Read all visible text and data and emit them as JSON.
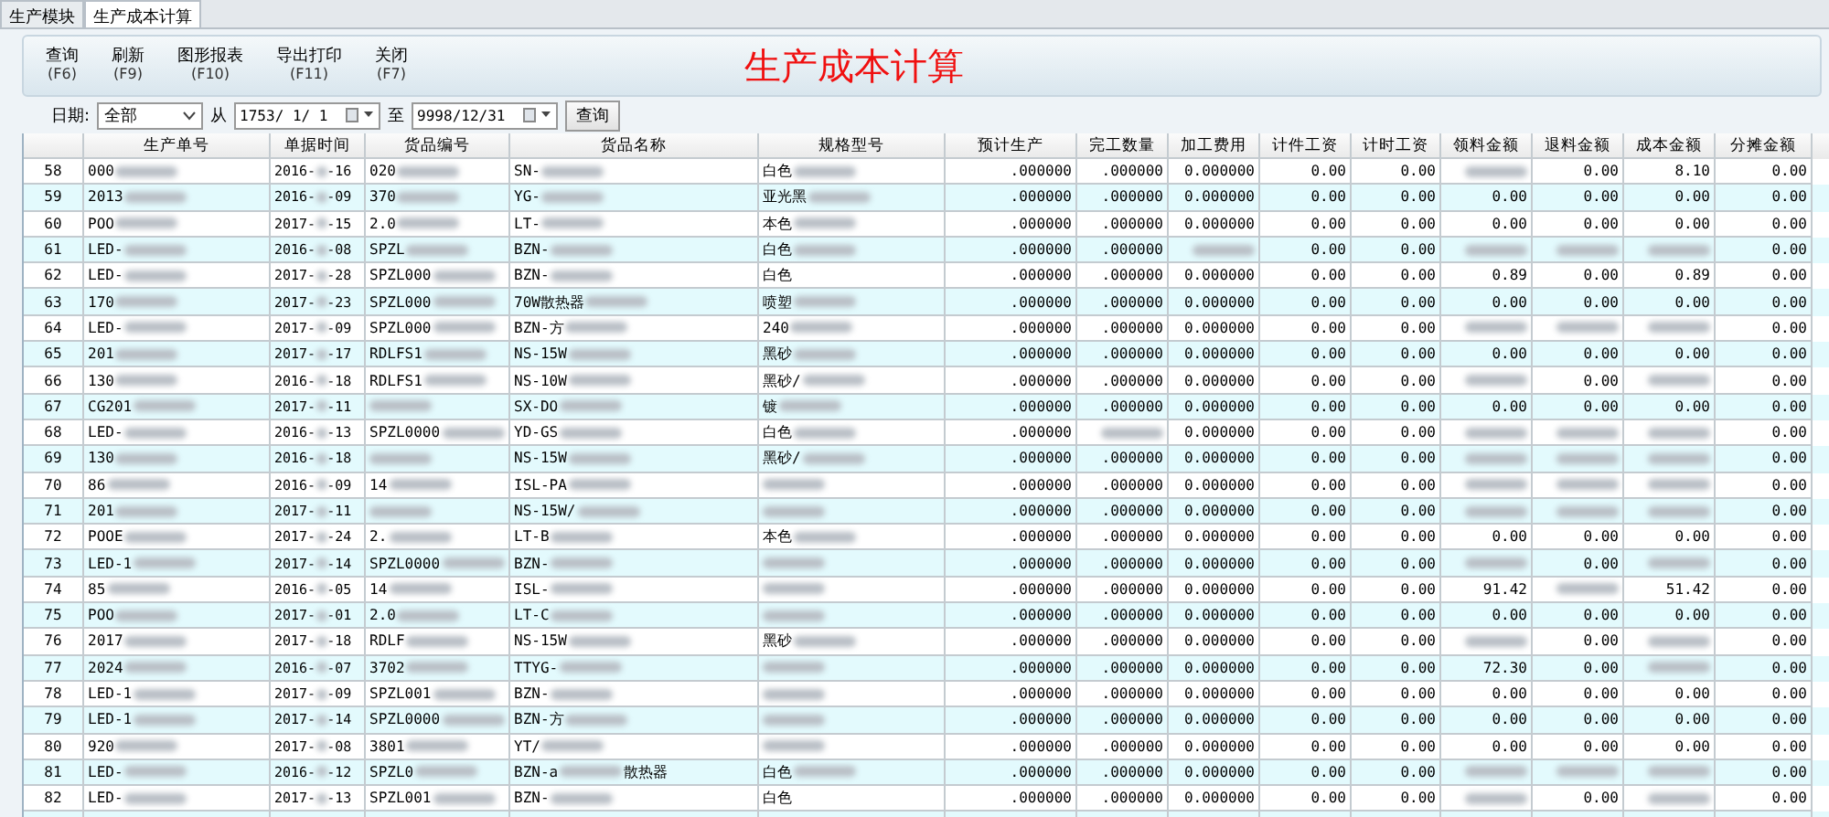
{
  "tabs": [
    {
      "label": "生产模块",
      "selected": false
    },
    {
      "label": "生产成本计算",
      "selected": true
    }
  ],
  "toolbar": [
    {
      "label": "查询",
      "key": "(F6)"
    },
    {
      "label": "刷新",
      "key": "(F9)"
    },
    {
      "label": "图形报表",
      "key": "(F10)"
    },
    {
      "label": "导出打印",
      "key": "(F11)"
    },
    {
      "label": "关闭",
      "key": "(F7)"
    }
  ],
  "title": "生产成本计算",
  "filter": {
    "date_label": "日期:",
    "range": "全部",
    "from_label": "从",
    "from": "1753/ 1/ 1",
    "to_label": "至",
    "to": "9998/12/31",
    "query": "查询"
  },
  "table": {
    "columns": [
      "",
      "生产单号",
      "单据时间",
      "货品编号",
      "货品名称",
      "规格型号",
      "预计生产",
      "完工数量",
      "加工费用",
      "计件工资",
      "计时工资",
      "领料金额",
      "退料金额",
      "成本金额",
      "分摊金额"
    ],
    "rows": [
      [
        "58",
        {
          "text": "000",
          "redacted": true
        },
        {
          "text": "2016-",
          "redacted": true,
          "tail": "-16"
        },
        {
          "text": "020",
          "redacted": true
        },
        {
          "text": "SN-",
          "redacted": true
        },
        {
          "text": "白色",
          "redacted": true
        },
        ".000000",
        ".000000",
        "0.000000",
        "0.00",
        "0.00",
        {
          "redacted": true
        },
        "0.00",
        "8.10",
        "0.00"
      ],
      [
        "59",
        {
          "text": "2013",
          "redacted": true
        },
        {
          "text": "2016-",
          "redacted": true,
          "tail": "-09"
        },
        {
          "text": "370",
          "redacted": true
        },
        {
          "text": "YG-",
          "redacted": true
        },
        {
          "text": "亚光黑",
          "redacted": true
        },
        ".000000",
        ".000000",
        "0.000000",
        "0.00",
        "0.00",
        "0.00",
        "0.00",
        "0.00",
        "0.00"
      ],
      [
        "60",
        {
          "text": "POO",
          "redacted": true
        },
        {
          "text": "2017-",
          "redacted": true,
          "tail": "-15"
        },
        {
          "text": "2.0",
          "redacted": true
        },
        {
          "text": "LT-",
          "redacted": true
        },
        {
          "text": "本色",
          "redacted": true
        },
        ".000000",
        ".000000",
        "0.000000",
        "0.00",
        "0.00",
        "0.00",
        "0.00",
        "0.00",
        "0.00"
      ],
      [
        "61",
        {
          "text": "LED-",
          "redacted": true
        },
        {
          "text": "2016-",
          "redacted": true,
          "tail": "-08"
        },
        {
          "text": "SPZL",
          "redacted": true
        },
        {
          "text": "BZN-",
          "redacted": true
        },
        {
          "text": "白色",
          "redacted": true
        },
        ".000000",
        ".000000",
        {
          "redacted": true
        },
        "0.00",
        "0.00",
        {
          "redacted": true
        },
        {
          "redacted": true
        },
        {
          "redacted": true
        },
        "0.00"
      ],
      [
        "62",
        {
          "text": "LED-",
          "redacted": true
        },
        {
          "text": "2017-",
          "redacted": true,
          "tail": "-28"
        },
        {
          "text": "SPZL000",
          "redacted": true
        },
        {
          "text": "BZN-",
          "redacted": true
        },
        "白色",
        ".000000",
        ".000000",
        "0.000000",
        "0.00",
        "0.00",
        "0.89",
        "0.00",
        "0.89",
        "0.00"
      ],
      [
        "63",
        {
          "text": "170",
          "redacted": true
        },
        {
          "text": "2017-",
          "redacted": true,
          "tail": "-23"
        },
        {
          "text": "SPZL000",
          "redacted": true
        },
        {
          "text": "70W散热器",
          "redacted": true
        },
        {
          "text": "喷塑",
          "redacted": true
        },
        ".000000",
        ".000000",
        "0.000000",
        "0.00",
        "0.00",
        "0.00",
        "0.00",
        "0.00",
        "0.00"
      ],
      [
        "64",
        {
          "text": "LED-",
          "redacted": true
        },
        {
          "text": "2017-",
          "redacted": true,
          "tail": "-09"
        },
        {
          "text": "SPZL000",
          "redacted": true
        },
        {
          "text": "BZN-方",
          "redacted": true
        },
        {
          "text": "240",
          "redacted": true
        },
        ".000000",
        ".000000",
        "0.000000",
        "0.00",
        "0.00",
        {
          "redacted": true
        },
        {
          "redacted": true
        },
        {
          "redacted": true
        },
        "0.00"
      ],
      [
        "65",
        {
          "text": "201",
          "redacted": true
        },
        {
          "text": "2017-",
          "redacted": true,
          "tail": "-17"
        },
        {
          "text": "RDLFS1",
          "redacted": true
        },
        {
          "text": "NS-15W",
          "redacted": true
        },
        {
          "text": "黑砂",
          "redacted": true
        },
        ".000000",
        ".000000",
        "0.000000",
        "0.00",
        "0.00",
        "0.00",
        "0.00",
        "0.00",
        "0.00"
      ],
      [
        "66",
        {
          "text": "130",
          "redacted": true
        },
        {
          "text": "2016-",
          "redacted": true,
          "tail": "-18"
        },
        {
          "text": "RDLFS1",
          "redacted": true
        },
        {
          "text": "NS-10W",
          "redacted": true
        },
        {
          "text": "黑砂/",
          "redacted": true
        },
        ".000000",
        ".000000",
        "0.000000",
        "0.00",
        "0.00",
        {
          "redacted": true
        },
        "0.00",
        {
          "redacted": true
        },
        "0.00"
      ],
      [
        "67",
        {
          "text": "CG201",
          "redacted": true
        },
        {
          "text": "2017-",
          "redacted": true,
          "tail": "-11"
        },
        {
          "redacted": true
        },
        {
          "text": "SX-DO",
          "redacted": true
        },
        {
          "text": "镀",
          "redacted": true
        },
        ".000000",
        ".000000",
        "0.000000",
        "0.00",
        "0.00",
        "0.00",
        "0.00",
        "0.00",
        "0.00"
      ],
      [
        "68",
        {
          "text": "LED-",
          "redacted": true
        },
        {
          "text": "2016-",
          "redacted": true,
          "tail": "-13"
        },
        {
          "text": "SPZL0000",
          "redacted": true
        },
        {
          "text": "YD-GS",
          "redacted": true
        },
        {
          "text": "白色",
          "redacted": true
        },
        ".000000",
        {
          "redacted": true
        },
        "0.000000",
        "0.00",
        "0.00",
        {
          "redacted": true
        },
        {
          "redacted": true
        },
        {
          "redacted": true
        },
        "0.00"
      ],
      [
        "69",
        {
          "text": "130",
          "redacted": true
        },
        {
          "text": "2016-",
          "redacted": true,
          "tail": "-18"
        },
        {
          "redacted": true
        },
        {
          "text": "NS-15W",
          "redacted": true
        },
        {
          "text": "黑砂/",
          "redacted": true
        },
        ".000000",
        ".000000",
        "0.000000",
        "0.00",
        "0.00",
        {
          "redacted": true
        },
        {
          "redacted": true
        },
        {
          "redacted": true
        },
        "0.00"
      ],
      [
        "70",
        {
          "text": "86",
          "redacted": true
        },
        {
          "text": "2016-",
          "redacted": true,
          "tail": "-09"
        },
        {
          "text": "14",
          "redacted": true
        },
        {
          "text": "ISL-PA",
          "redacted": true
        },
        {
          "redacted": true
        },
        ".000000",
        ".000000",
        "0.000000",
        "0.00",
        "0.00",
        {
          "redacted": true
        },
        {
          "redacted": true
        },
        {
          "redacted": true
        },
        "0.00"
      ],
      [
        "71",
        {
          "text": "201",
          "redacted": true
        },
        {
          "text": "2017-",
          "redacted": true,
          "tail": "-11"
        },
        {
          "redacted": true
        },
        {
          "text": "NS-15W/",
          "redacted": true
        },
        {
          "redacted": true
        },
        ".000000",
        ".000000",
        "0.000000",
        "0.00",
        "0.00",
        {
          "redacted": true
        },
        {
          "redacted": true
        },
        {
          "redacted": true
        },
        "0.00"
      ],
      [
        "72",
        {
          "text": "POOE",
          "redacted": true
        },
        {
          "text": "2017-",
          "redacted": true,
          "tail": "-24"
        },
        {
          "text": "2.",
          "redacted": true
        },
        {
          "text": "LT-B",
          "redacted": true
        },
        {
          "text": "本色",
          "redacted": true
        },
        ".000000",
        ".000000",
        "0.000000",
        "0.00",
        "0.00",
        "0.00",
        "0.00",
        "0.00",
        "0.00"
      ],
      [
        "73",
        {
          "text": "LED-1",
          "redacted": true
        },
        {
          "text": "2017-",
          "redacted": true,
          "tail": "-14"
        },
        {
          "text": "SPZL0000",
          "redacted": true
        },
        {
          "text": "BZN-",
          "redacted": true
        },
        {
          "redacted": true
        },
        ".000000",
        ".000000",
        "0.000000",
        "0.00",
        "0.00",
        {
          "redacted": true
        },
        "0.00",
        {
          "redacted": true
        },
        "0.00"
      ],
      [
        "74",
        {
          "text": "85",
          "redacted": true
        },
        {
          "text": "2016-",
          "redacted": true,
          "tail": "-05"
        },
        {
          "text": "14",
          "redacted": true
        },
        {
          "text": "ISL-",
          "redacted": true
        },
        {
          "redacted": true
        },
        ".000000",
        ".000000",
        "0.000000",
        "0.00",
        "0.00",
        "91.42",
        {
          "redacted": true
        },
        "51.42",
        "0.00"
      ],
      [
        "75",
        {
          "text": "POO",
          "redacted": true
        },
        {
          "text": "2017-",
          "redacted": true,
          "tail": "-01"
        },
        {
          "text": "2.0",
          "redacted": true
        },
        {
          "text": "LT-C",
          "redacted": true
        },
        {
          "redacted": true
        },
        ".000000",
        ".000000",
        "0.000000",
        "0.00",
        "0.00",
        "0.00",
        "0.00",
        "0.00",
        "0.00"
      ],
      [
        "76",
        {
          "text": "2017",
          "redacted": true
        },
        {
          "text": "2017-",
          "redacted": true,
          "tail": "-18"
        },
        {
          "text": "RDLF",
          "redacted": true
        },
        {
          "text": "NS-15W",
          "redacted": true
        },
        {
          "text": "黑砂",
          "redacted": true
        },
        ".000000",
        ".000000",
        "0.000000",
        "0.00",
        "0.00",
        {
          "redacted": true
        },
        "0.00",
        {
          "redacted": true
        },
        "0.00"
      ],
      [
        "77",
        {
          "text": "2024",
          "redacted": true
        },
        {
          "text": "2016-",
          "redacted": true,
          "tail": "-07"
        },
        {
          "text": "3702",
          "redacted": true
        },
        {
          "text": "TTYG-",
          "redacted": true
        },
        {
          "redacted": true
        },
        ".000000",
        ".000000",
        "0.000000",
        "0.00",
        "0.00",
        "72.30",
        "0.00",
        {
          "redacted": true
        },
        "0.00"
      ],
      [
        "78",
        {
          "text": "LED-1",
          "redacted": true
        },
        {
          "text": "2017-",
          "redacted": true,
          "tail": "-09"
        },
        {
          "text": "SPZL001",
          "redacted": true
        },
        {
          "text": "BZN-",
          "redacted": true
        },
        {
          "redacted": true
        },
        ".000000",
        ".000000",
        "0.000000",
        "0.00",
        "0.00",
        "0.00",
        "0.00",
        "0.00",
        "0.00"
      ],
      [
        "79",
        {
          "text": "LED-1",
          "redacted": true
        },
        {
          "text": "2017-",
          "redacted": true,
          "tail": "-14"
        },
        {
          "text": "SPZL0000",
          "redacted": true
        },
        {
          "text": "BZN-方",
          "redacted": true
        },
        {
          "redacted": true
        },
        ".000000",
        ".000000",
        "0.000000",
        "0.00",
        "0.00",
        "0.00",
        "0.00",
        "0.00",
        "0.00"
      ],
      [
        "80",
        {
          "text": "920",
          "redacted": true
        },
        {
          "text": "2017-",
          "redacted": true,
          "tail": "-08"
        },
        {
          "text": "3801",
          "redacted": true
        },
        {
          "text": "YT/",
          "redacted": true
        },
        {
          "redacted": true
        },
        ".000000",
        ".000000",
        "0.000000",
        "0.00",
        "0.00",
        "0.00",
        "0.00",
        "0.00",
        "0.00"
      ],
      [
        "81",
        {
          "text": "LED-",
          "redacted": true
        },
        {
          "text": "2016-",
          "redacted": true,
          "tail": "-12"
        },
        {
          "text": "SPZL0",
          "redacted": true
        },
        {
          "text": "BZN-a",
          "redacted": true,
          "tail": "散热器"
        },
        {
          "text": "白色",
          "redacted": true
        },
        ".000000",
        ".000000",
        "0.000000",
        "0.00",
        "0.00",
        {
          "redacted": true
        },
        {
          "redacted": true
        },
        {
          "redacted": true
        },
        "0.00"
      ],
      [
        "82",
        {
          "text": "LED-",
          "redacted": true
        },
        {
          "text": "2017-",
          "redacted": true,
          "tail": "-13"
        },
        {
          "text": "SPZL001",
          "redacted": true
        },
        {
          "text": "BZN-",
          "redacted": true
        },
        "白色",
        ".000000",
        ".000000",
        "0.000000",
        "0.00",
        "0.00",
        {
          "redacted": true
        },
        "0.00",
        {
          "redacted": true
        },
        "0.00"
      ]
    ]
  }
}
